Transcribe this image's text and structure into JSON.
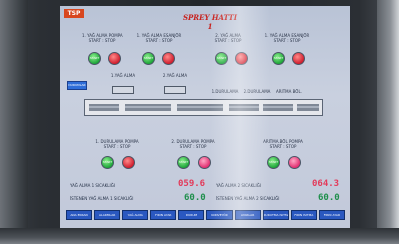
{
  "header": {
    "logo": "TSP",
    "title": "SPREY HATTI 1"
  },
  "top_labels": [
    "1. YAĞ ALMA POMPA\nSTART : STOP",
    "1. YAĞ ALMA ESANJÖR\nSTART : STOP",
    "2. YAĞ ALMA\nSTART : STOP",
    "1. YAĞ ALMA ESANJÖR\nSTART : STOP"
  ],
  "mid_labels": [
    "1.YAĞ ALMA",
    "2.YAĞ ALMA",
    "1.DURULAMA",
    "2.DURULAMA",
    "ARITMA BÖL."
  ],
  "blue_button": "DURUMLAR",
  "lower_labels": [
    "1. DURULAMA POMPA\nSTART : STOP",
    "2. DURULAMA POMPA\nSTART : STOP",
    "ARITMA.BÖL POMPA\nSTART : STOP"
  ],
  "buttons": {
    "start": "START",
    "stop": "STOP"
  },
  "readouts": {
    "left_temp_label": "YAĞ ALMA 1 SICAKLIĞI",
    "left_temp_value": "059.6",
    "left_set_label": "İSTENEN YAĞ ALMA 1 SICAKLIĞI",
    "left_set_value": "60.0",
    "right_temp_label": "YAĞ ALMA 2 SICAKLIĞI",
    "right_temp_value": "064.3",
    "right_set_label": "İSTENEN YAĞ ALMA 2 SICAKLIĞI",
    "right_set_value": "60.0"
  },
  "bottom_bar": [
    "ANA EKRAN",
    "ALARMLAR",
    "YAĞ ALMA",
    "FIRIN AYAR",
    "DURUM",
    "KONVEYÖR",
    "AYARLAR",
    "KURUTMA ISITMA",
    "FIRIN ISITMA",
    "FIRIN AYAR"
  ]
}
